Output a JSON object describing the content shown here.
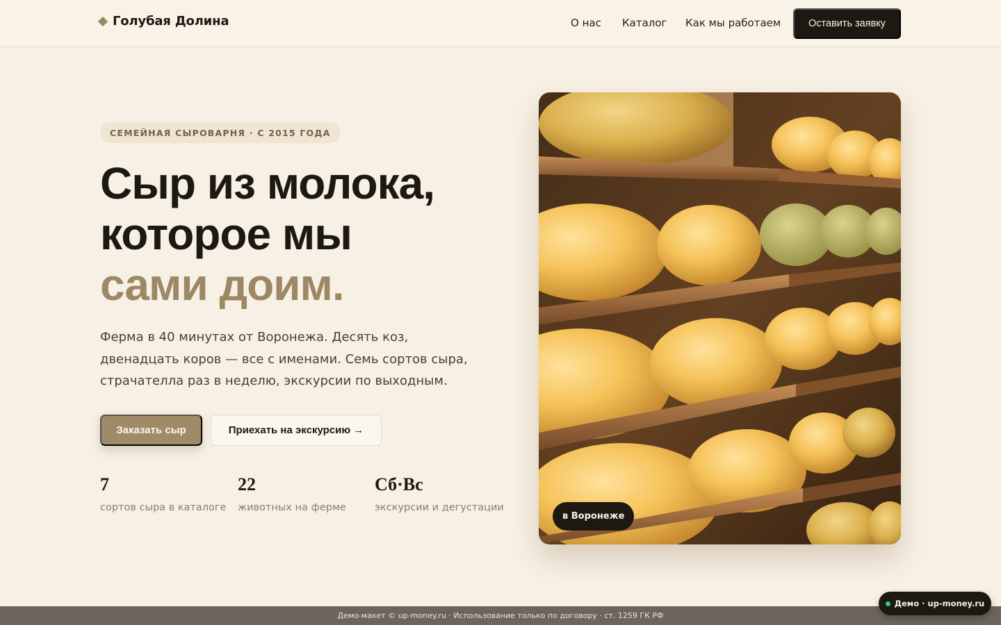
{
  "header": {
    "brand": "Голубая Долина",
    "brand_icon": "diamond-icon",
    "nav": [
      "О нас",
      "Каталог",
      "Как мы работаем"
    ],
    "cta": "Оставить заявку"
  },
  "hero": {
    "badge": "СЕМЕЙНАЯ СЫРОВАРНЯ · С 2015 ГОДА",
    "title_line1": "Сыр из молока,",
    "title_line2": "которое мы",
    "title_accent": "сами доим.",
    "lead": "Ферма в 40 минутах от Воронежа. Десять коз, двенадцать коров — все с именами. Семь сортов сыра, страчателла раз в неделю, экскурсии по выходным.",
    "primary_button": "Заказать сыр",
    "secondary_button": "Приехать на экскурсию →",
    "stats": [
      {
        "value": "7",
        "label": "сортов сыра в каталоге"
      },
      {
        "value": "22",
        "label": "животных на ферме"
      },
      {
        "value": "Сб·Вс",
        "label": "экскурсии и дегустации"
      }
    ],
    "image_tag": "в Воронеже"
  },
  "footer": {
    "legal": "Демо-макет © up-money.ru · Использование только по договору · ст. 1259 ГК РФ",
    "demo_badge": "Демо · up-money.ru"
  },
  "colors": {
    "background": "#f7f0e4",
    "accent": "#a08b69",
    "dark": "#1e1812"
  }
}
